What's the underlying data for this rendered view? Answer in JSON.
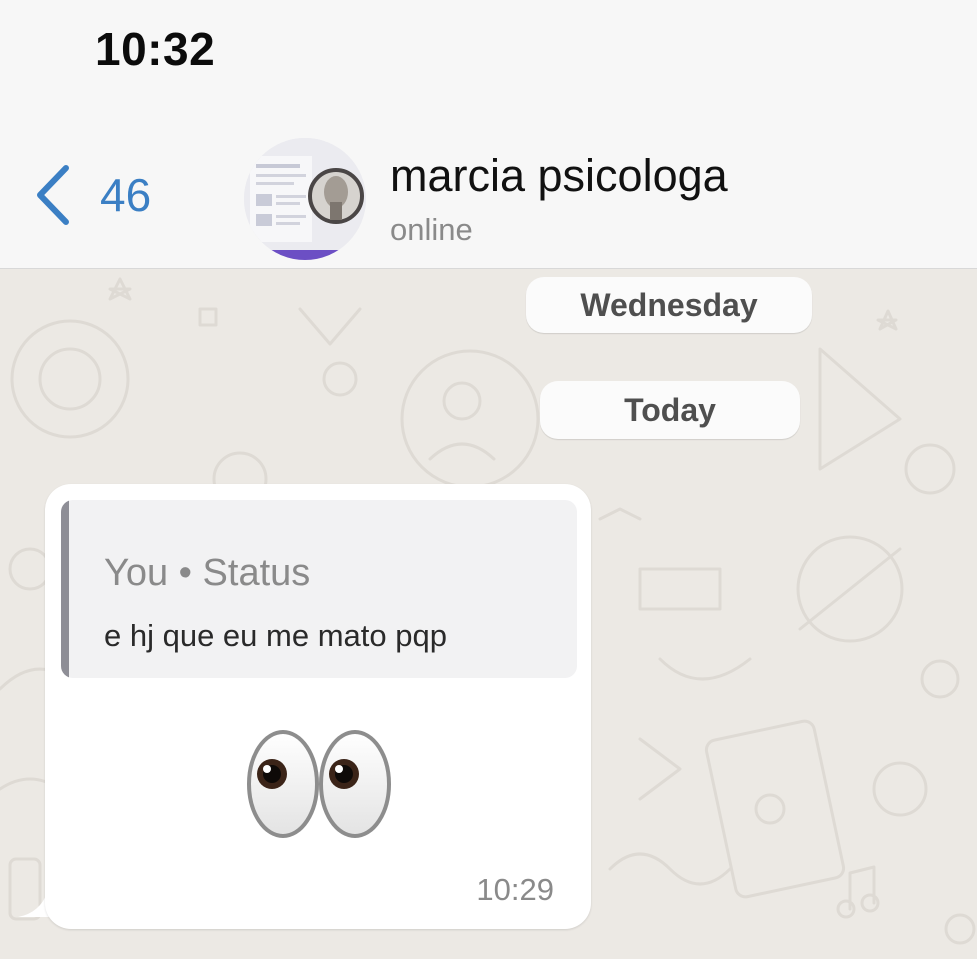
{
  "status_bar": {
    "time": "10:32"
  },
  "header": {
    "back_count": "46",
    "contact_name": "marcia psicologa",
    "contact_status": "online"
  },
  "date_chips": {
    "wednesday": "Wednesday",
    "today": "Today"
  },
  "message": {
    "quote_author": "You • Status",
    "quote_text": "e hj que eu me mato pqp",
    "emoji": "eyes",
    "time": "10:29"
  },
  "colors": {
    "accent_blue": "#3b7fc4",
    "chat_background": "#ece9e4",
    "bubble": "#ffffff",
    "quote_bar": "#8e8e96"
  },
  "icons": [
    "chevron-left-icon",
    "eyes-emoji"
  ]
}
